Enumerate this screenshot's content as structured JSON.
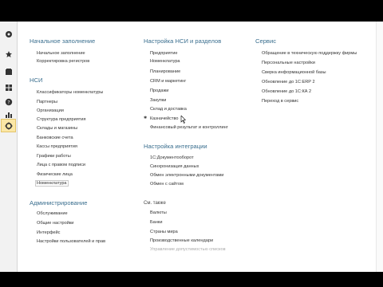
{
  "sidebar": {
    "icons": [
      "home-icon",
      "favorite-icon",
      "documents-icon",
      "grid-icon",
      "help-icon",
      "chart-icon",
      "gear-icon"
    ]
  },
  "col1": {
    "s1": {
      "title": "Начальное заполнение",
      "items": [
        "Начальное заполнение",
        "Корректировка регистров"
      ]
    },
    "s2": {
      "title": "НСИ",
      "items": [
        "Классификаторы номенклатуры",
        "Партнеры",
        "Организации",
        "Структура предприятия",
        "Склады и магазины",
        "Банковские счета",
        "Кассы предприятия",
        "Графики работы",
        "Лица с правом подписи",
        "Физические лица",
        "Номенклатура"
      ]
    },
    "s3": {
      "title": "Администрирование",
      "items": [
        "Обслуживание",
        "Общие настройки",
        "Интерфейс",
        "Настройки пользователей и прав"
      ]
    }
  },
  "col2": {
    "s1": {
      "title": "Настройка НСИ и разделов",
      "items": [
        "Предприятие",
        "Номенклатура",
        "Планирование",
        "CRM и маркетинг",
        "Продажи",
        "Закупки",
        "Склад и доставка",
        "Казначейство",
        "Финансовый результат и контроллинг"
      ]
    },
    "s2": {
      "title": "Настройка интеграции",
      "items": [
        "1С:Документооборот",
        "Синхронизация данных",
        "Обмен электронными документами",
        "Обмен с сайтом"
      ]
    },
    "s3": {
      "title": "См. также",
      "items": [
        "Валюты",
        "Банки",
        "Страны мира",
        "Производственные календари",
        "Управление допустимостью списков"
      ]
    }
  },
  "col3": {
    "s1": {
      "title": "Сервис",
      "items": [
        "Обращение в техническую поддержку фирмы",
        "Персональные настройки",
        "Сверка информационной базы",
        "Обновление до 1С:ERP 2",
        "Обновление до 1С:КА 2",
        "Переход в сервис"
      ]
    }
  },
  "colors": {
    "section_title": "#3b6f8f",
    "highlight_bg": "#fbe7a6"
  }
}
